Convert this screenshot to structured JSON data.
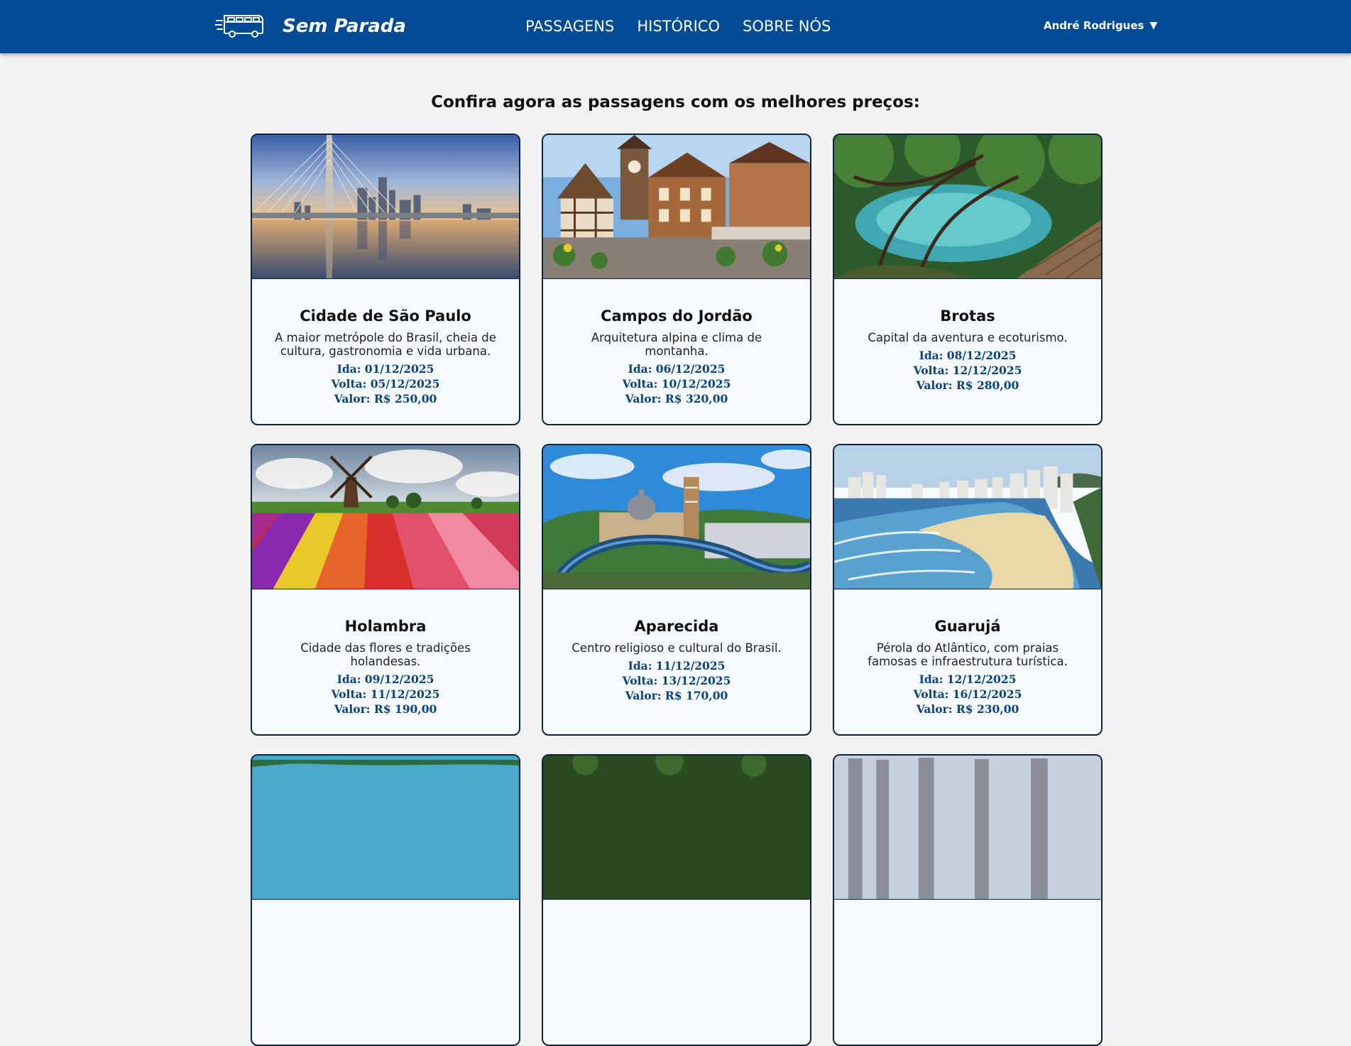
{
  "nav": {
    "brand": "Sem Parada",
    "brand_icon": "bus-icon",
    "links": [
      "PASSAGENS",
      "HISTÓRICO",
      "SOBRE NÓS"
    ],
    "user_name": "André Rodrigues",
    "user_caret": "▼",
    "bg_color": "#004b93"
  },
  "main": {
    "heading": "Confira agora as passagens com os melhores preços:"
  },
  "cards": [
    {
      "title": "Cidade de São Paulo",
      "description": "A maior metrópole do Brasil, cheia de cultura, gastronomia e vida urbana.",
      "ida": "Ida: 01/12/2025",
      "volta": "Volta: 05/12/2025",
      "valor": "Valor: R$ 250,00",
      "image": "sao-paulo-bridge-image"
    },
    {
      "title": "Campos do Jordão",
      "description": "Arquitetura alpina e clima de montanha.",
      "ida": "Ida: 06/12/2025",
      "volta": "Volta: 10/12/2025",
      "valor": "Valor: R$ 320,00",
      "image": "campos-do-jordao-village-image"
    },
    {
      "title": "Brotas",
      "description": "Capital da aventura e ecoturismo.",
      "ida": "Ida: 08/12/2025",
      "volta": "Volta: 12/12/2025",
      "valor": "Valor: R$ 280,00",
      "image": "brotas-lagoon-image"
    },
    {
      "title": "Holambra",
      "description": "Cidade das flores e tradições holandesas.",
      "ida": "Ida: 09/12/2025",
      "volta": "Volta: 11/12/2025",
      "valor": "Valor: R$ 190,00",
      "image": "holambra-windmill-image"
    },
    {
      "title": "Aparecida",
      "description": "Centro religioso e cultural do Brasil.",
      "ida": "Ida: 11/12/2025",
      "volta": "Volta: 13/12/2025",
      "valor": "Valor: R$ 170,00",
      "image": "aparecida-basilica-image"
    },
    {
      "title": "Guarujá",
      "description": "Pérola do Atlântico, com praias famosas e infraestrutura turística.",
      "ida": "Ida: 12/12/2025",
      "volta": "Volta: 16/12/2025",
      "valor": "Valor: R$ 230,00",
      "image": "guaruja-beach-image"
    }
  ]
}
